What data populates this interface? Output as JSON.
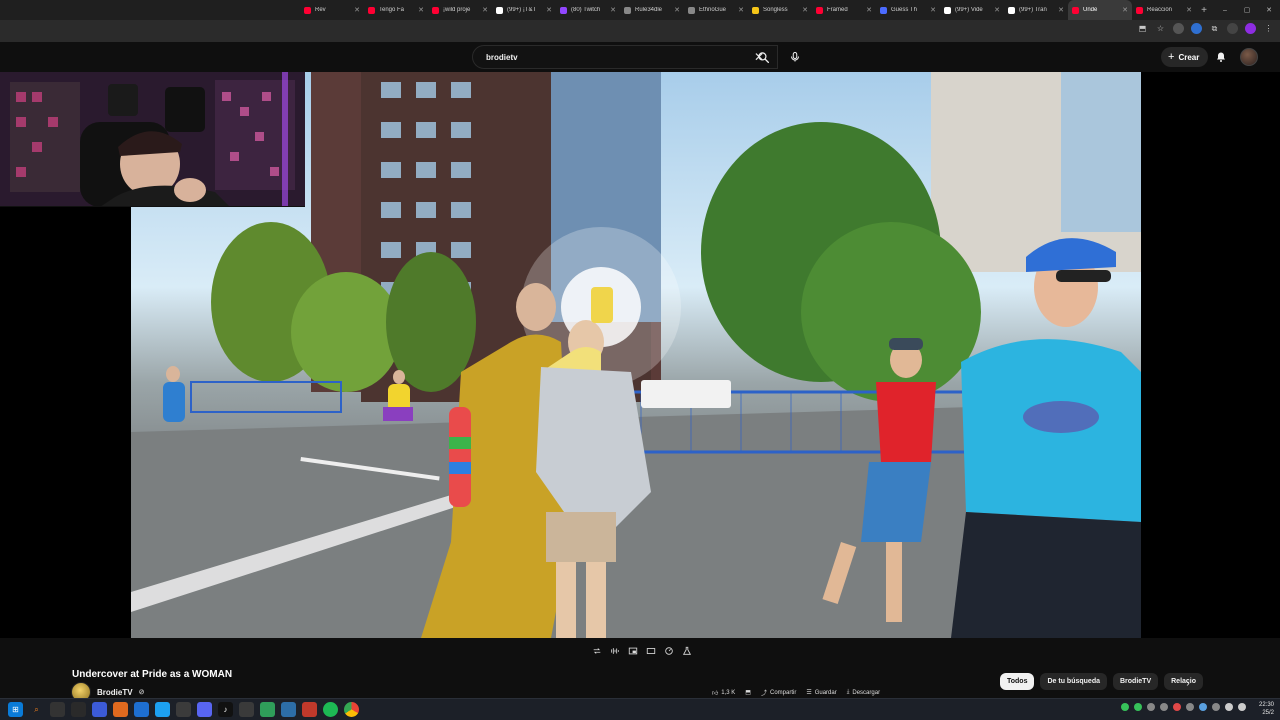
{
  "browser": {
    "tabs": [
      {
        "label": "Rev",
        "color": "#ff0033"
      },
      {
        "label": "Tengo Fa",
        "color": "#ff0033"
      },
      {
        "label": "¡wild proje",
        "color": "#ff0033"
      },
      {
        "label": "(99+) ¡T&T",
        "color": "#ffffff"
      },
      {
        "label": "(80) Twitch",
        "color": "#9146ff"
      },
      {
        "label": "Rule34dle",
        "color": "#888888"
      },
      {
        "label": "EthnoGue",
        "color": "#888888"
      },
      {
        "label": "Songless",
        "color": "#f5c518"
      },
      {
        "label": "Framed",
        "color": "#ff0033"
      },
      {
        "label": "Guess Th",
        "color": "#4b6bff"
      },
      {
        "label": "(99+) Vide",
        "color": "#ffffff"
      },
      {
        "label": "(99+) Tran",
        "color": "#ffffff"
      },
      {
        "label": "Unde",
        "color": "#ff0033"
      },
      {
        "label": "Reacción",
        "color": "#ff0033"
      }
    ],
    "new_tab": "+",
    "window_controls": [
      "–",
      "▢",
      "✕"
    ],
    "active_tab_index": 12
  },
  "youtube": {
    "search": {
      "value": "brodietv"
    },
    "create_label": "Crear",
    "video_title": "Undercover at Pride as a WOMAN",
    "channel_name": "BrodieTV",
    "verified_mark": "⊘",
    "actions": [
      "1,3 K",
      "",
      "Compartir",
      "Guardar",
      "Descargar"
    ],
    "chips": [
      "Todos",
      "De tu búsqueda",
      "BrodieTV",
      "Relacio"
    ],
    "chip_next": "›"
  },
  "player_controls": [
    "loop-icon",
    "audio-track-icon",
    "miniplayer-icon",
    "speed-icon",
    "lab-icon"
  ],
  "taskbar": {
    "time": "22:30",
    "date": "25/2"
  }
}
